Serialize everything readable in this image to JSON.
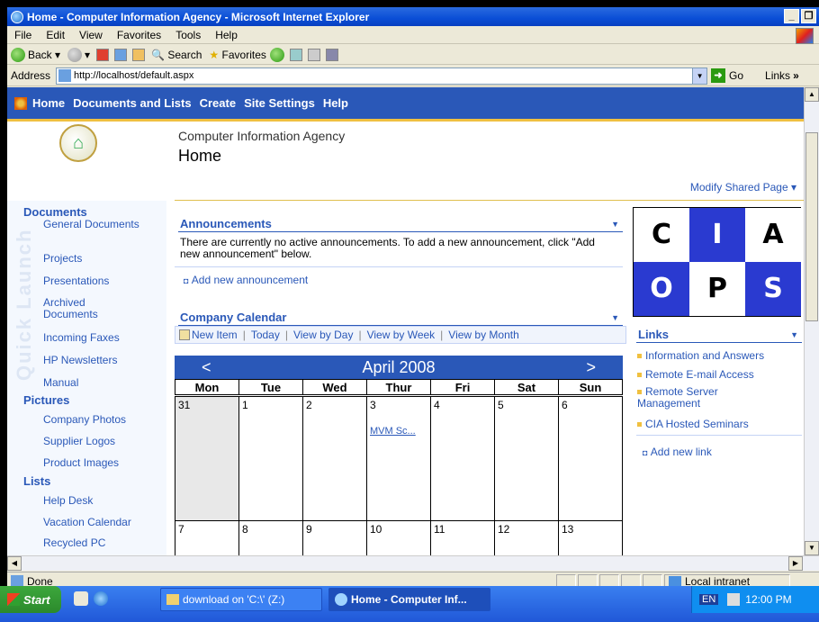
{
  "window": {
    "title": "Home - Computer Information Agency - Microsoft Internet Explorer"
  },
  "menu": [
    "File",
    "Edit",
    "View",
    "Favorites",
    "Tools",
    "Help"
  ],
  "toolbar": {
    "back": "Back",
    "search": "Search",
    "favorites": "Favorites"
  },
  "address": {
    "label": "Address",
    "url": "http://localhost/default.aspx",
    "go": "Go",
    "links": "Links"
  },
  "topnav": [
    "Home",
    "Documents and Lists",
    "Create",
    "Site Settings",
    "Help"
  ],
  "header": {
    "site_name": "Computer Information Agency",
    "page_title": "Home",
    "modify": "Modify Shared Page"
  },
  "quicklaunch": {
    "watermark": "Quick Launch",
    "documents_heading": "Documents",
    "documents": [
      "General Documents",
      "Projects",
      "Presentations",
      "Archived Documents",
      "Incoming Faxes",
      "HP Newsletters",
      "Manual"
    ],
    "pictures_heading": "Pictures",
    "pictures": [
      "Company Photos",
      "Supplier Logos",
      "Product Images"
    ],
    "lists_heading": "Lists",
    "lists": [
      "Help Desk",
      "Vacation Calendar",
      "Recycled PC"
    ]
  },
  "announcements": {
    "title": "Announcements",
    "text": "There are currently no active announcements. To add a new announcement, click \"Add new announcement\" below.",
    "add": "Add new announcement"
  },
  "calendar": {
    "title": "Company Calendar",
    "toolbar": [
      "New Item",
      "Today",
      "View by Day",
      "View by Week",
      "View by Month"
    ],
    "prev": "<",
    "next": ">",
    "month": "April 2008",
    "days": [
      "Mon",
      "Tue",
      "Wed",
      "Thur",
      "Fri",
      "Sat",
      "Sun"
    ],
    "week1": [
      "31",
      "1",
      "2",
      "3",
      "4",
      "5",
      "6"
    ],
    "week2": [
      "7",
      "8",
      "9",
      "10",
      "11",
      "12",
      "13"
    ],
    "event": "MVM Sc..."
  },
  "logo": {
    "letters": [
      "C",
      "I",
      "A",
      "O",
      "P",
      "S"
    ]
  },
  "links": {
    "title": "Links",
    "items": [
      "Information and Answers",
      "Remote E-mail Access",
      "Remote Server Management",
      "CIA Hosted Seminars"
    ],
    "add": "Add new link"
  },
  "status": {
    "text": "Done",
    "zone": "Local intranet"
  },
  "taskbar": {
    "start": "Start",
    "items": [
      "download on 'C:\\' (Z:)",
      "Home - Computer Inf..."
    ],
    "lang": "EN",
    "clock": "12:00 PM"
  }
}
